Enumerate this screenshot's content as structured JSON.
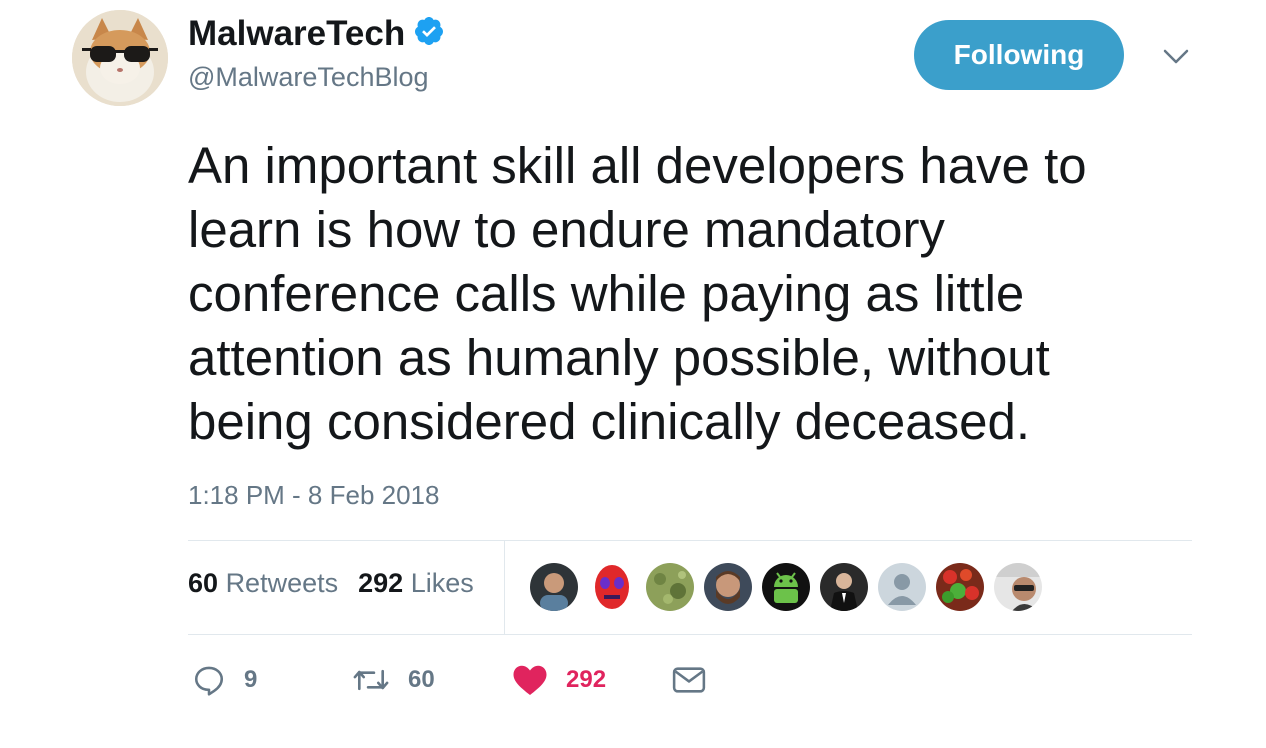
{
  "author": {
    "display_name": "MalwareTech",
    "handle": "@MalwareTechBlog",
    "verified": true,
    "avatar": "cat-with-sunglasses-avatar"
  },
  "follow_button": {
    "label": "Following",
    "color": "#3b9fcb"
  },
  "menu_caret": "chevron-down-icon",
  "tweet": {
    "text_lines": [
      "An important skill all developers have to",
      "learn is how to endure mandatory",
      "conference calls while paying as little",
      "attention as humanly possible, without",
      "being considered clinically deceased."
    ],
    "timestamp": "1:18 PM - 8 Feb 2018"
  },
  "stats": {
    "retweets_count": "60",
    "retweets_label": "Retweets",
    "likes_count": "292",
    "likes_label": "Likes"
  },
  "liker_avatars": [
    "man-avatar",
    "red-mask-avatar",
    "green-field-avatar",
    "bearded-man-avatar",
    "android-avatar",
    "suit-man-avatar",
    "default-avatar",
    "fruit-avatar",
    "man-glasses-avatar"
  ],
  "actions": {
    "reply_count": "9",
    "retweet_count": "60",
    "like_count": "292",
    "like_color": "#e0245e",
    "icon_color": "#657786"
  }
}
